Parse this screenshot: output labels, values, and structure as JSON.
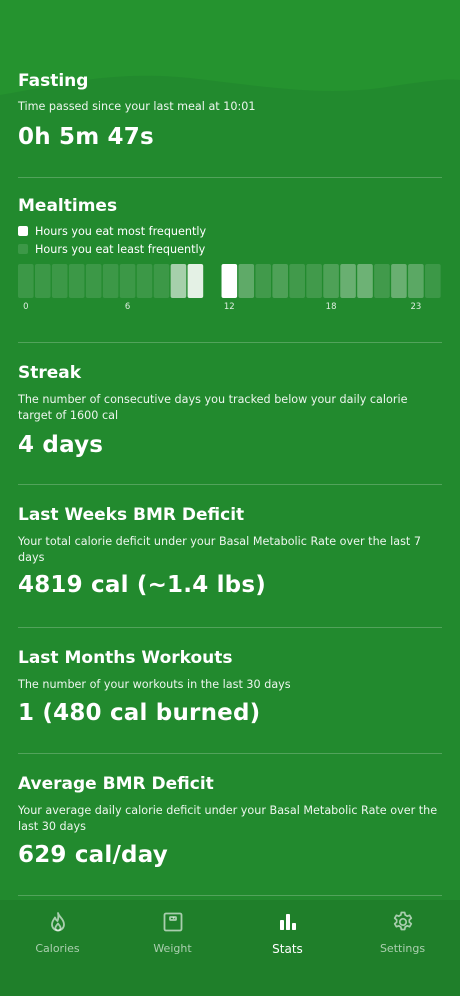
{
  "fasting": {
    "title": "Fasting",
    "description": "Time passed since your last meal at 10:01",
    "value": "0h 5m 47s"
  },
  "mealtimes": {
    "title": "Mealtimes",
    "legend_most": "Hours you eat most frequently",
    "legend_least": "Hours you eat least frequently",
    "hour_intensity": [
      0.12,
      0.12,
      0.12,
      0.12,
      0.12,
      0.12,
      0.12,
      0.12,
      0.12,
      0.6,
      0.88,
      0,
      1.0,
      0.28,
      0.14,
      0.2,
      0.14,
      0.14,
      0.2,
      0.32,
      0.34,
      0.14,
      0.32,
      0.26,
      0.12
    ],
    "tick_labels": [
      "0",
      "6",
      "12",
      "18",
      "23"
    ],
    "tick_hours": [
      0,
      6,
      12,
      18,
      23
    ]
  },
  "streak": {
    "title": "Streak",
    "description": "The number of consecutive days you tracked below your daily calorie target of 1600 cal",
    "value": "4 days"
  },
  "bmr_week": {
    "title": "Last Weeks BMR Deficit",
    "description": "Your total calorie deficit under your Basal Metabolic Rate over the last 7 days",
    "value": "4819 cal (~1.4 lbs)"
  },
  "workouts": {
    "title": "Last Months Workouts",
    "description": "The number of your workouts in the last 30 days",
    "value": "1 (480 cal burned)"
  },
  "bmr_avg": {
    "title": "Average BMR Deficit",
    "description": "Your average daily calorie deficit under your Basal Metabolic Rate over the last 30 days",
    "value": "629 cal/day"
  },
  "tabbar": {
    "tabs": [
      {
        "label": "Calories",
        "icon": "flame-icon",
        "active": false
      },
      {
        "label": "Weight",
        "icon": "scale-icon",
        "active": false
      },
      {
        "label": "Stats",
        "icon": "bar-chart-icon",
        "active": true
      },
      {
        "label": "Settings",
        "icon": "gear-icon",
        "active": false
      }
    ]
  },
  "colors": {
    "background": "#228a2e",
    "tabbar": "#1f7f2a",
    "text": "#ffffff"
  }
}
